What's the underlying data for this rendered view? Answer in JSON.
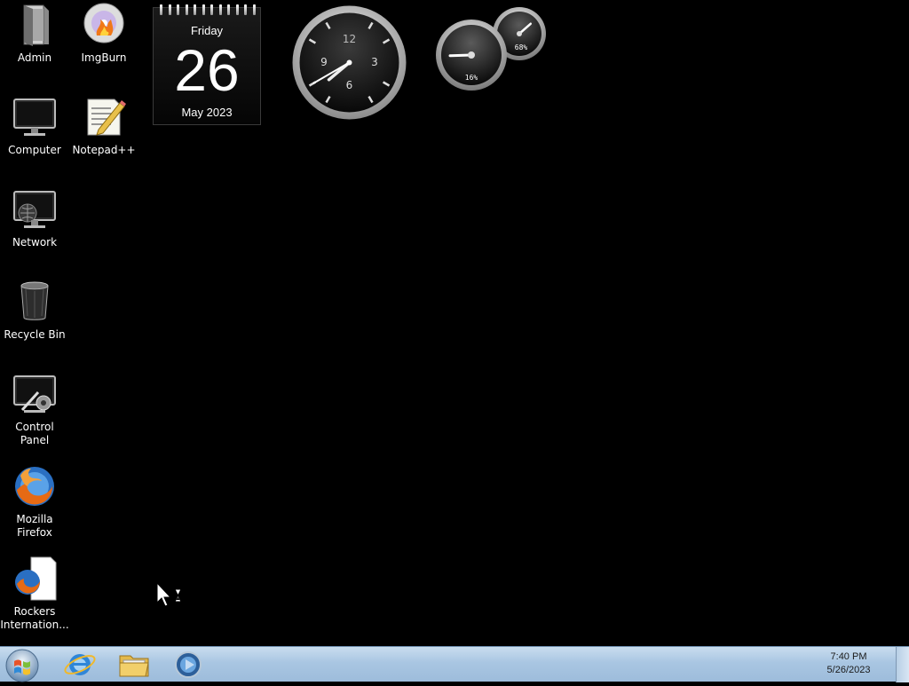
{
  "desktop": {
    "icons": [
      {
        "label": "Admin",
        "icon": "user-folder-icon"
      },
      {
        "label": "ImgBurn",
        "icon": "disc-flame-icon"
      },
      {
        "label": "Computer",
        "icon": "computer-monitor-icon"
      },
      {
        "label": "Notepad++",
        "icon": "notepad-icon"
      },
      {
        "label": "Network",
        "icon": "network-icon"
      },
      {
        "label": "Recycle Bin",
        "icon": "recycle-bin-icon"
      },
      {
        "label": "Control Panel",
        "icon": "control-panel-icon"
      },
      {
        "label": "Mozilla Firefox",
        "icon": "firefox-icon"
      },
      {
        "label": "Rockers Internation...",
        "icon": "firefox-shortcut-file-icon"
      }
    ]
  },
  "gadgets": {
    "calendar": {
      "day": "Friday",
      "date": "26",
      "month_year": "May 2023"
    },
    "clock": {
      "numerals": [
        "12",
        "3",
        "6",
        "9"
      ],
      "hour": 7,
      "minute": 40
    },
    "cpu_meter": {
      "cpu": "16%",
      "memory": "68%",
      "cpu_fraction": 0.16,
      "memory_fraction": 0.68
    }
  },
  "taskbar": {
    "start": "start-orb-icon",
    "pinned": [
      {
        "name": "Internet Explorer",
        "icon": "internet-explorer-icon"
      },
      {
        "name": "Windows Explorer",
        "icon": "folder-library-icon"
      },
      {
        "name": "Windows Media Player",
        "icon": "media-player-icon"
      }
    ],
    "tray": {
      "time": "7:40 PM",
      "date": "5/26/2023"
    }
  },
  "colors": {
    "desktop_bg": "#000000",
    "taskbar": "#a9c6e2"
  }
}
